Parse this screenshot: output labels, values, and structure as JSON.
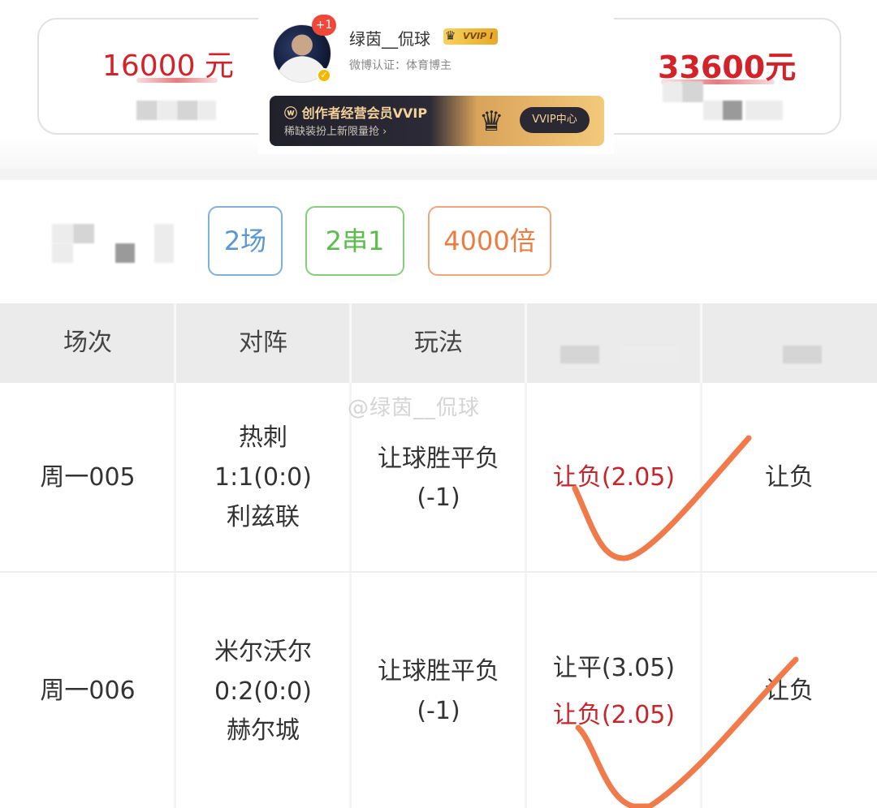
{
  "summary": {
    "left_amount": "16000 元",
    "right_amount": "33600元"
  },
  "user_card": {
    "notification_badge": "+1",
    "username": "绿茵__侃球",
    "vip_badge": "VVIP Ⅰ",
    "verification": "微博认证：体育博主",
    "banner": {
      "title": "创作者经营会员VVIP",
      "subtitle": "稀缺装扮上新限量抢 ›",
      "button": "VVIP中心"
    }
  },
  "tags": {
    "matches": "2场",
    "parlay": "2串1",
    "multiplier": "4000倍"
  },
  "table": {
    "headers": [
      "场次",
      "对阵",
      "玩法"
    ],
    "rows": [
      {
        "match_id": "周一005",
        "home": "热刺",
        "score": "1:1(0:0)",
        "away": "利兹联",
        "play_type": "让球胜平负",
        "handicap": "(-1)",
        "picks": [
          "让负(2.05)"
        ],
        "result": "让负"
      },
      {
        "match_id": "周一006",
        "home": "米尔沃尔",
        "score": "0:2(0:0)",
        "away": "赫尔城",
        "play_type": "让球胜平负",
        "handicap": "(-1)",
        "picks": [
          "让平(3.05)",
          "让负(2.05)"
        ],
        "result": "让负"
      }
    ]
  },
  "watermark": "@绿茵__侃球",
  "colors": {
    "accent_red": "#d2232a",
    "check_orange": "#f07a4a",
    "tag_blue": "#5b97d2",
    "tag_green": "#5cbd4c",
    "tag_orange": "#ec7d42"
  }
}
